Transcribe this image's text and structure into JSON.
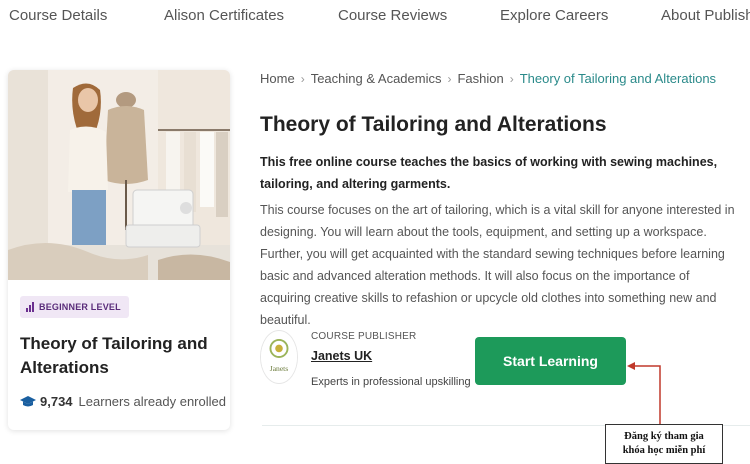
{
  "topnav": {
    "items": [
      "Course Details",
      "Alison Certificates",
      "Course Reviews",
      "Explore Careers",
      "About Publisher"
    ]
  },
  "card": {
    "level": "BEGINNER LEVEL",
    "title": "Theory of Tailoring and Alterations",
    "enrolled_count": "9,734",
    "enrolled_label": "Learners already enrolled"
  },
  "breadcrumb": {
    "items": [
      "Home",
      "Teaching & Academics",
      "Fashion"
    ],
    "current": "Theory of Tailoring and Alterations"
  },
  "course": {
    "title": "Theory of Tailoring and Alterations",
    "subtitle": "This free online course teaches the basics of working with sewing machines, tailoring, and altering garments.",
    "description": "This course focuses on the art of tailoring, which is a vital skill for anyone interested in designing. You will learn about the tools, equipment, and setting up a workspace. Further, you will get acquainted with the standard sewing techniques before learning basic and advanced alteration methods. It will also focus on the importance of acquiring creative skills to refashion or upcycle old clothes into something new and beautiful."
  },
  "publisher": {
    "caption": "COURSE PUBLISHER",
    "name": "Janets UK",
    "tagline": "Experts in professional upskilling",
    "logo_text": "Janets"
  },
  "cta": {
    "label": "Start Learning"
  },
  "annotation": {
    "line1": "Đăng ký tham gia",
    "line2": "khóa học miễn phí"
  },
  "colors": {
    "accent_green": "#1d9a5a",
    "breadcrumb_current": "#2a8a8a",
    "badge_bg": "#f0e7f5",
    "annotation_arrow": "#c0392b"
  },
  "icons": {
    "level": "signal-bars-icon",
    "enrolled": "graduation-cap-icon",
    "breadcrumb_sep": "chevron-right-icon"
  }
}
